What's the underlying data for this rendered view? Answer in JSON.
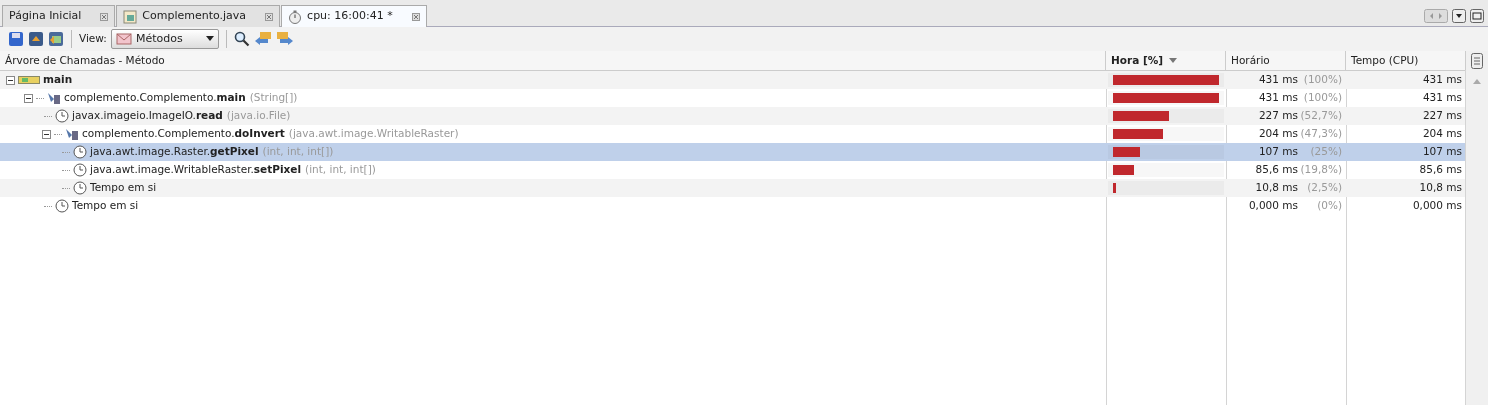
{
  "tabs": [
    {
      "label": "Página Inicial",
      "kind": "plain",
      "selected": false
    },
    {
      "label": "Complemento.java",
      "kind": "java",
      "selected": false
    },
    {
      "label": "cpu: 16:00:41 *",
      "kind": "timer",
      "selected": true
    }
  ],
  "toolbar": {
    "view_label": "View:",
    "view_value": "Métodos"
  },
  "table": {
    "columns": [
      "Árvore de Chamadas - Método",
      "Hora [%]",
      "Horário",
      "Tempo (CPU)"
    ],
    "rows": [
      {
        "kind": "thread",
        "prefix": "main",
        "expanded": true,
        "selected": false,
        "level": 1,
        "time": "431 ms",
        "percent": "(100%)",
        "cpu": "431 ms",
        "children": [
          {
            "kind": "method",
            "prefix": "complemento.Complemento.",
            "name": "main",
            "params": "(String[])",
            "expanded": true,
            "selected": false,
            "level": 1,
            "time": "431 ms",
            "percent": "(100%)",
            "cpu": "431 ms",
            "children": [
              {
                "kind": "leaf",
                "prefix": "javax.imageio.ImageIO.",
                "name": "read",
                "params": "(java.io.File)",
                "selected": false,
                "level": 0.527,
                "time": "227 ms",
                "percent": "(52,7%)",
                "cpu": "227 ms"
              },
              {
                "kind": "method",
                "prefix": "complemento.Complemento.",
                "name": "doInvert",
                "params": "(java.awt.image.WritableRaster)",
                "expanded": true,
                "selected": false,
                "level": 0.473,
                "time": "204 ms",
                "percent": "(47,3%)",
                "cpu": "204 ms",
                "children": [
                  {
                    "kind": "leaf",
                    "prefix": "java.awt.image.Raster.",
                    "name": "getPixel",
                    "params": "(int, int, int[])",
                    "selected": true,
                    "level": 0.25,
                    "time": "107 ms",
                    "percent": "(25%)",
                    "cpu": "107 ms"
                  },
                  {
                    "kind": "leaf",
                    "prefix": "java.awt.image.WritableRaster.",
                    "name": "setPixel",
                    "params": "(int, int, int[])",
                    "selected": false,
                    "level": 0.198,
                    "time": "85,6 ms",
                    "percent": "(19,8%)",
                    "cpu": "85,6 ms"
                  },
                  {
                    "kind": "leaf",
                    "prefix": "Tempo em si",
                    "selected": false,
                    "level": 0.025,
                    "time": "10,8 ms",
                    "percent": "(2,5%)",
                    "cpu": "10,8 ms"
                  }
                ]
              },
              {
                "kind": "leaf",
                "prefix": "Tempo em si",
                "selected": false,
                "level": 0,
                "time": "0,000 ms",
                "percent": "(0%)",
                "cpu": "0,000 ms"
              }
            ]
          }
        ]
      }
    ]
  }
}
